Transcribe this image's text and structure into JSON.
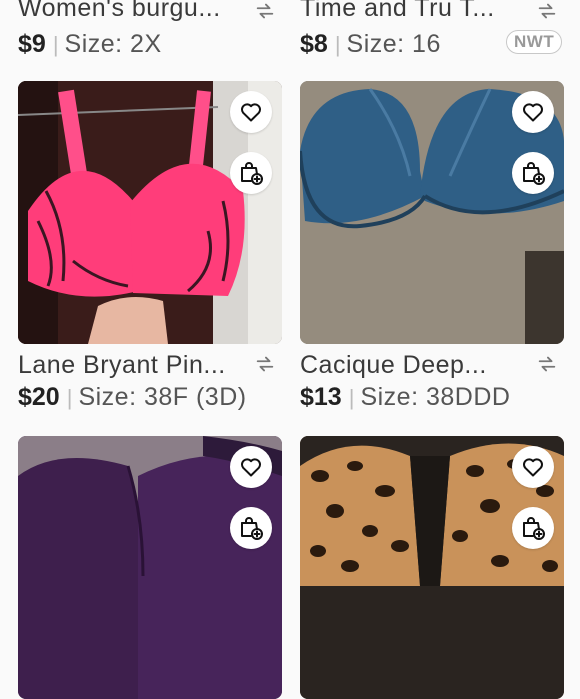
{
  "listings": [
    {
      "title": "Women's burgu...",
      "price": "$9",
      "size": "Size: 2X",
      "badge": ""
    },
    {
      "title": "Time and Tru T...",
      "price": "$8",
      "size": "Size: 16",
      "badge": "NWT"
    },
    {
      "title": "Lane Bryant Pin...",
      "price": "$20",
      "size": "Size: 38F (3D)",
      "badge": ""
    },
    {
      "title": "Cacique Deep...",
      "price": "$13",
      "size": "Size: 38DDD",
      "badge": ""
    },
    {
      "title": "",
      "price": "",
      "size": "",
      "badge": ""
    },
    {
      "title": "",
      "price": "",
      "size": "",
      "badge": ""
    }
  ],
  "icons": {
    "like": "heart-icon",
    "bundle": "bag-add-icon",
    "swap": "swap-arrows-icon"
  },
  "colors": {
    "background": "#fafafa",
    "price_text": "#222222",
    "badge_border": "#c8c8c8"
  }
}
